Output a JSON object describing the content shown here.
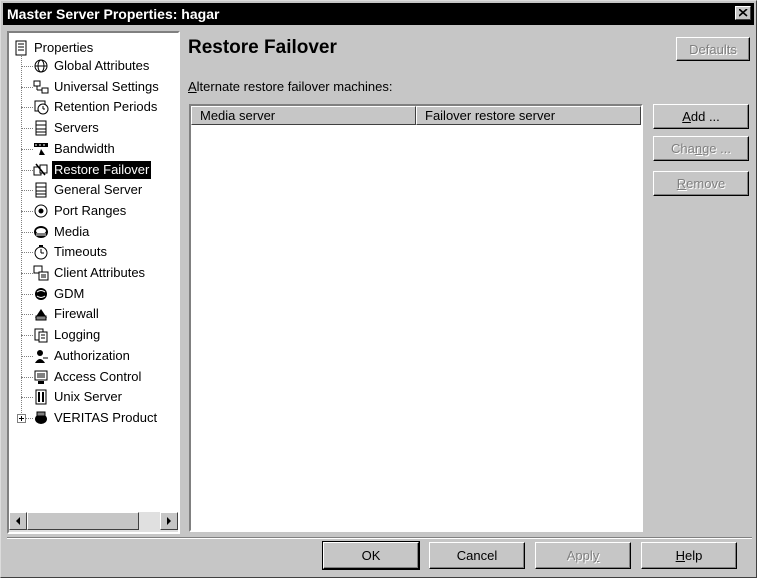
{
  "window": {
    "title": "Master Server Properties: hagar"
  },
  "tree": {
    "root_label": "Properties",
    "items": [
      {
        "label": "Global Attributes",
        "icon": "globe-icon"
      },
      {
        "label": "Universal Settings",
        "icon": "network-icon"
      },
      {
        "label": "Retention Periods",
        "icon": "clock-icon"
      },
      {
        "label": "Servers",
        "icon": "server-icon"
      },
      {
        "label": "Bandwidth",
        "icon": "bandwidth-icon"
      },
      {
        "label": "Restore Failover",
        "icon": "failover-icon",
        "selected": true
      },
      {
        "label": "General Server",
        "icon": "server-icon"
      },
      {
        "label": "Port Ranges",
        "icon": "radio-icon"
      },
      {
        "label": "Media",
        "icon": "tape-icon"
      },
      {
        "label": "Timeouts",
        "icon": "stopwatch-icon"
      },
      {
        "label": "Client Attributes",
        "icon": "client-icon"
      },
      {
        "label": "GDM",
        "icon": "gdm-icon"
      },
      {
        "label": "Firewall",
        "icon": "firewall-icon"
      },
      {
        "label": "Logging",
        "icon": "log-icon"
      },
      {
        "label": "Authorization",
        "icon": "user-key-icon"
      },
      {
        "label": "Access Control",
        "icon": "access-icon"
      },
      {
        "label": "Unix Server",
        "icon": "unix-icon"
      },
      {
        "label": "VERITAS Product",
        "icon": "veritas-icon",
        "expandable": true
      }
    ]
  },
  "main": {
    "title": "Restore Failover",
    "defaults_label": "Defaults",
    "machines_label_mnemonic": "A",
    "machines_label_rest": "lternate restore failover machines:",
    "columns": [
      "Media server",
      "Failover restore server"
    ],
    "rows": [],
    "add_label": "Add ...",
    "change_label": "Change ...",
    "remove_label": "Remove"
  },
  "footer": {
    "ok_label": "OK",
    "cancel_label": "Cancel",
    "apply_label": "Apply",
    "help_label": "Help"
  },
  "colors": {
    "dialog_bg": "#c6c6c6",
    "titlebar_bg": "#000000",
    "selection_bg": "#000000",
    "disabled_text": "#808080"
  }
}
